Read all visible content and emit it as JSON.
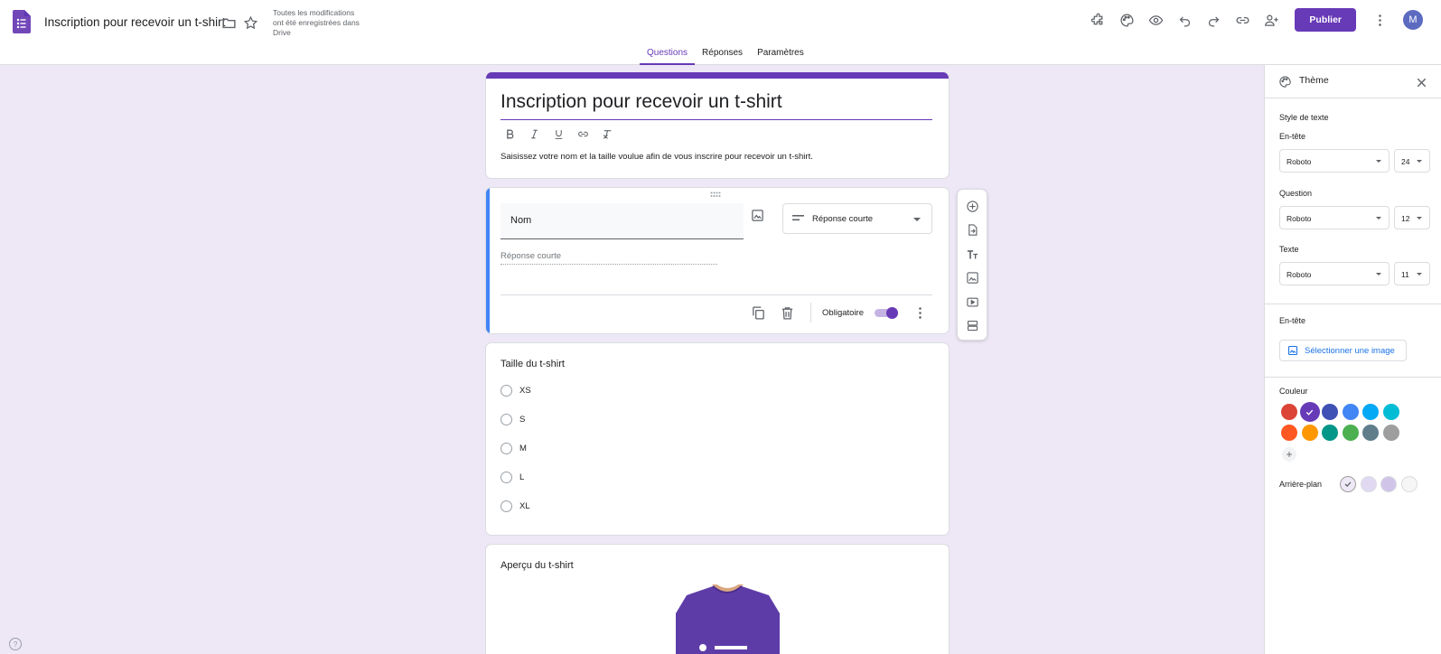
{
  "app": {
    "doc_title": "Inscription pour recevoir un t-shirt",
    "save_status": "Toutes les modifications ont été enregistrées dans Drive",
    "publish_label": "Publier",
    "avatar_letter": "M"
  },
  "tabs": [
    {
      "label": "Questions",
      "active": true
    },
    {
      "label": "Réponses",
      "active": false
    },
    {
      "label": "Paramètres",
      "active": false
    }
  ],
  "form": {
    "title": "Inscription pour recevoir un t-shirt",
    "description": "Saisissez votre nom et la taille voulue afin de vous inscrire pour recevoir un t-shirt."
  },
  "question1": {
    "title": "Nom",
    "type_label": "Réponse courte",
    "answer_hint": "Réponse courte",
    "required_label": "Obligatoire",
    "required": true
  },
  "question2": {
    "title": "Taille du t-shirt",
    "options": [
      "XS",
      "S",
      "M",
      "L",
      "XL"
    ]
  },
  "question3": {
    "title": "Aperçu du t-shirt"
  },
  "theme": {
    "title": "Thème",
    "text_style_label": "Style de texte",
    "header_label": "En-tête",
    "header_font": "Roboto",
    "header_size": "24",
    "question_label": "Question",
    "question_font": "Roboto",
    "question_size": "12",
    "text_label": "Texte",
    "text_font": "Roboto",
    "text_size": "11",
    "header_image_label": "En-tête",
    "select_image_label": "Sélectionner une image",
    "color_label": "Couleur",
    "colors": [
      "#db4437",
      "#673ab7",
      "#3f51b5",
      "#4285f4",
      "#03a9f4",
      "#00bcd4",
      "#ff5722",
      "#ff9800",
      "#009688",
      "#4caf50",
      "#607d8b",
      "#9e9e9e"
    ],
    "selected_color": "#673ab7",
    "background_label": "Arrière-plan",
    "backgrounds": [
      "#ede7f6",
      "#e1d8f1",
      "#d1c4e9",
      "#f6f6f6"
    ],
    "selected_background": "#ede7f6"
  }
}
